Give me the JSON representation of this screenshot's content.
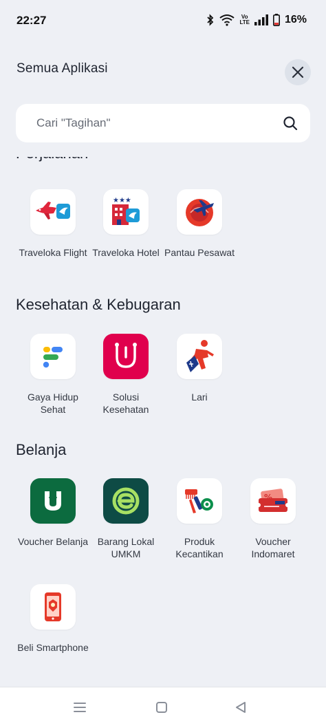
{
  "status_bar": {
    "time": "22:27",
    "battery": "16%",
    "volte": [
      "Vo",
      "LTE"
    ]
  },
  "header": {
    "title": "Semua Aplikasi"
  },
  "search": {
    "placeholder": "Cari \"Tagihan\""
  },
  "sections": [
    {
      "title": "Perjalanan",
      "apps": [
        {
          "label": "Traveloka Flight",
          "icon": "traveloka-flight-icon"
        },
        {
          "label": "Traveloka Hotel",
          "icon": "traveloka-hotel-icon"
        },
        {
          "label": "Pantau Pesawat",
          "icon": "pantau-pesawat-icon"
        }
      ]
    },
    {
      "title": "Kesehatan & Kebugaran",
      "apps": [
        {
          "label": "Gaya Hidup Sehat",
          "icon": "gaya-hidup-sehat-icon"
        },
        {
          "label": "Solusi Kesehatan",
          "icon": "solusi-kesehatan-icon"
        },
        {
          "label": "Lari",
          "icon": "lari-icon"
        }
      ]
    },
    {
      "title": "Belanja",
      "apps": [
        {
          "label": "Voucher Belanja",
          "icon": "voucher-belanja-icon"
        },
        {
          "label": "Barang Lokal UMKM",
          "icon": "barang-lokal-icon"
        },
        {
          "label": "Produk Kecantikan",
          "icon": "produk-kecantikan-icon"
        },
        {
          "label": "Voucher Indomaret",
          "icon": "voucher-indomaret-icon"
        },
        {
          "label": "Beli Smartphone",
          "icon": "beli-smartphone-icon"
        }
      ]
    }
  ],
  "nav_bar": {
    "icons": [
      "menu-icon",
      "home-icon",
      "back-icon"
    ]
  },
  "colors": {
    "background": "#eef0f5",
    "accent_red": "#e0004d",
    "green": "#0c6b3f",
    "teal": "#0e4b45"
  }
}
